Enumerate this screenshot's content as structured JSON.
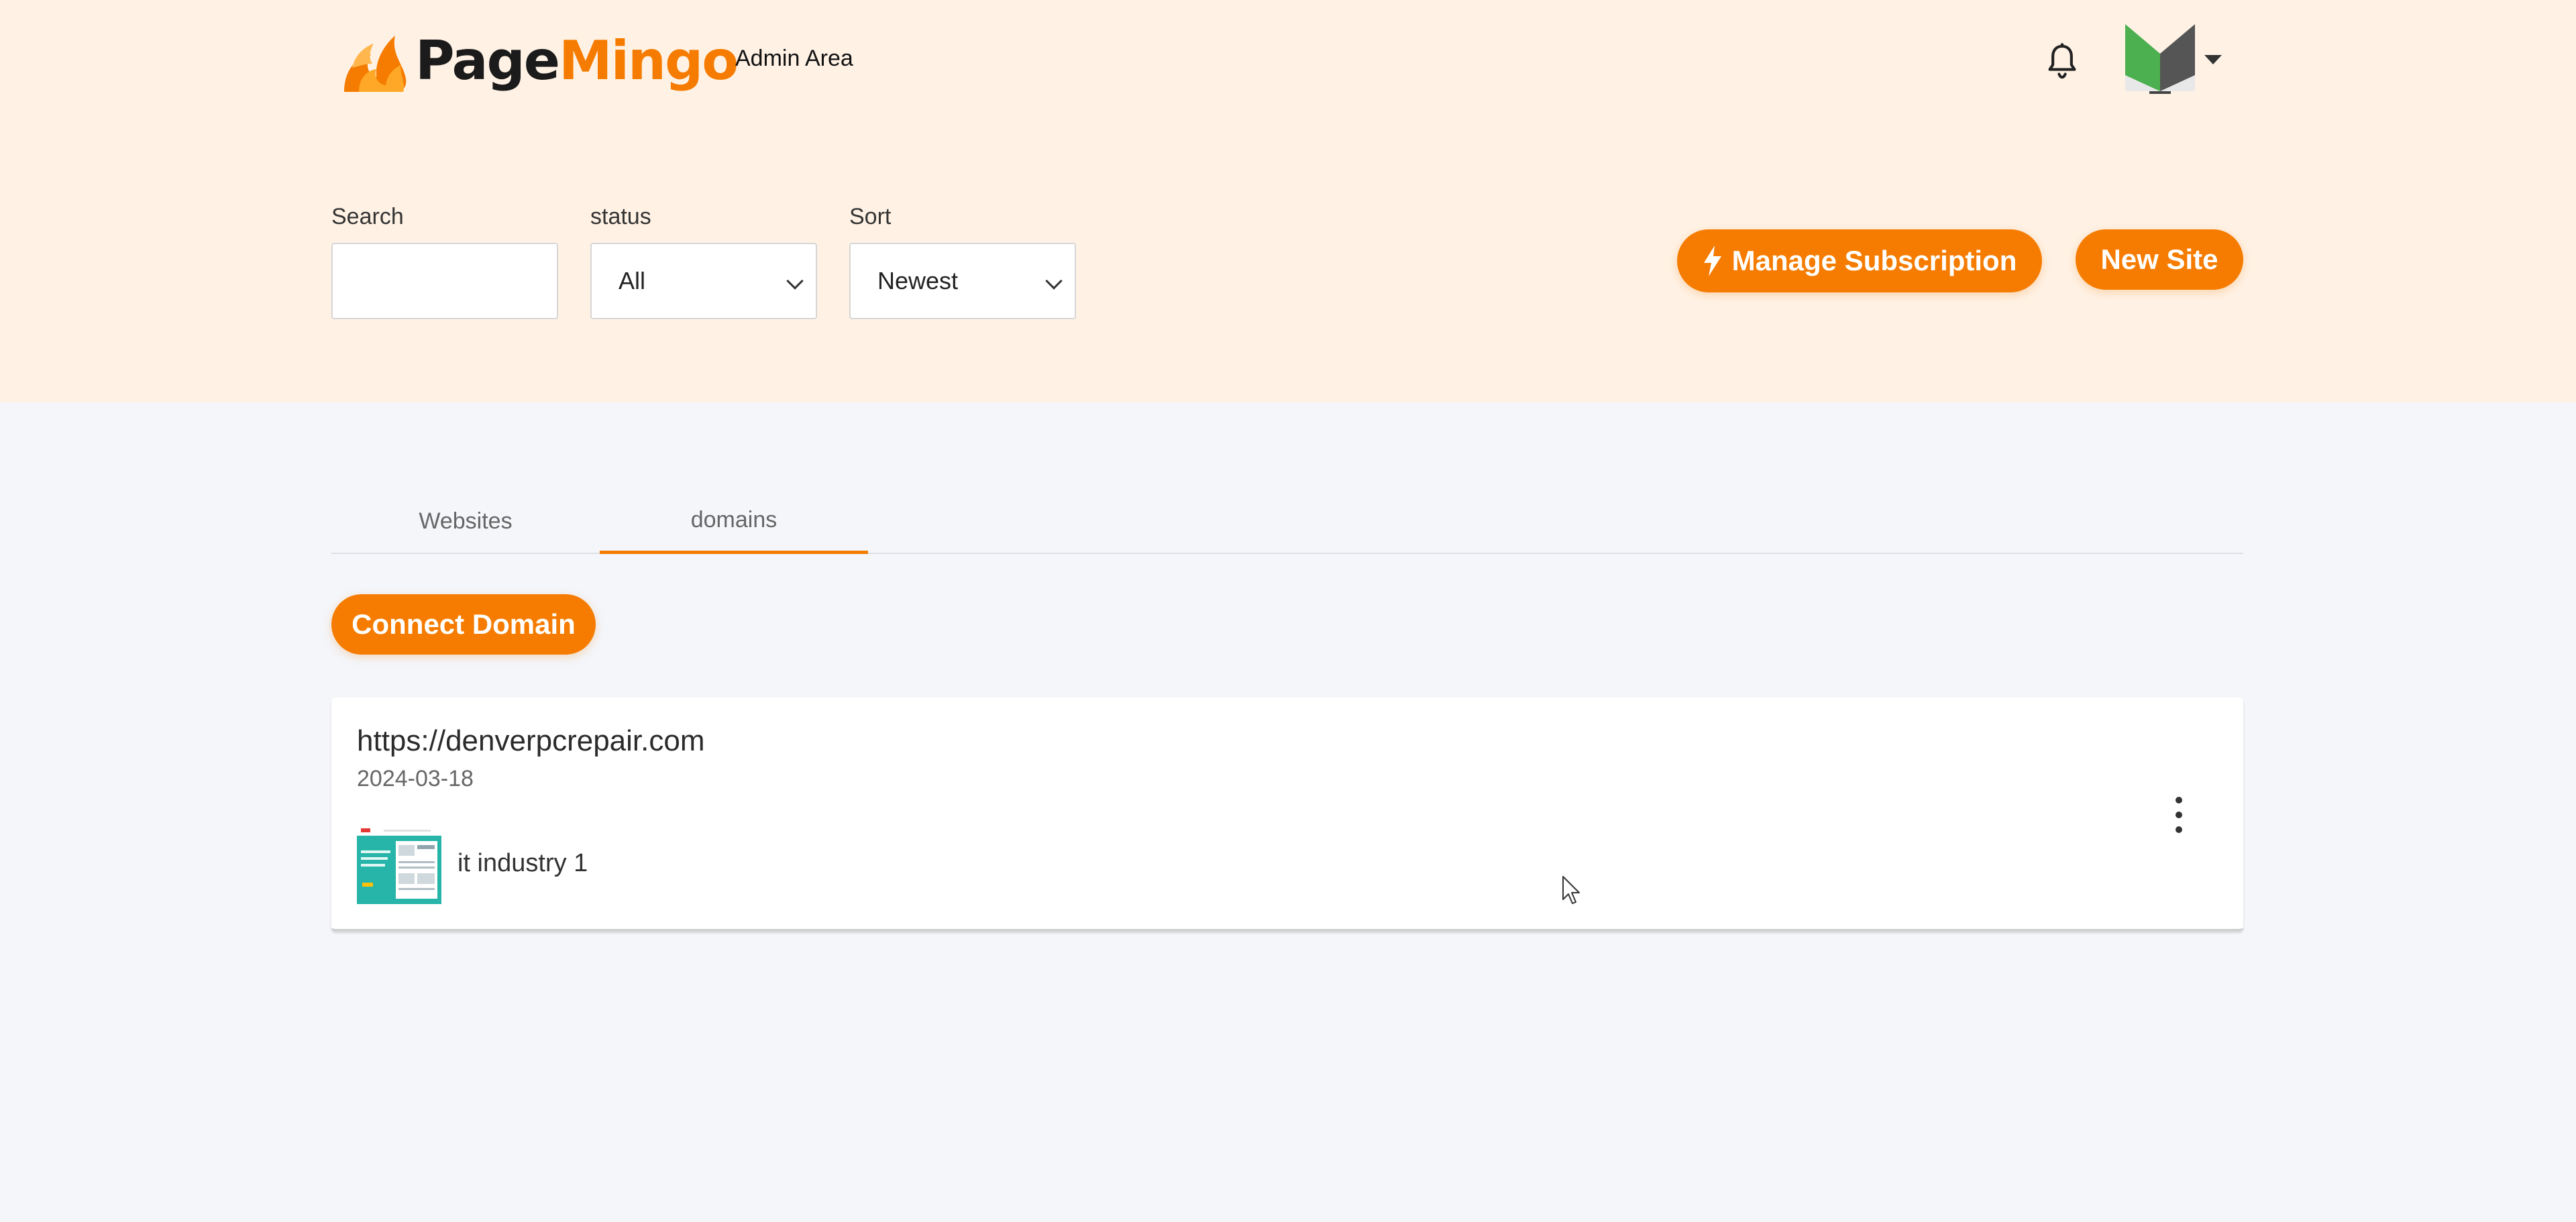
{
  "brand": {
    "part1": "Page",
    "part2": "Mingo",
    "accent": "#f57c00"
  },
  "header": {
    "admin_link": "Admin Area"
  },
  "icons": {
    "notifications": "bell-icon",
    "avatar": "user-avatar-icon",
    "menu": "chevron-down-icon",
    "bolt": "lightning-icon",
    "more": "kebab-menu-icon"
  },
  "filters": {
    "search": {
      "label": "Search",
      "value": ""
    },
    "status": {
      "label": "status",
      "selected": "All"
    },
    "sort": {
      "label": "Sort",
      "selected": "Newest"
    }
  },
  "actions": {
    "manage_subscription": "Manage Subscription",
    "new_site": "New Site",
    "connect_domain": "Connect Domain"
  },
  "tabs": [
    {
      "label": "Websites",
      "active": false
    },
    {
      "label": "domains",
      "active": true
    }
  ],
  "domains": [
    {
      "url": "https://denverpcrepair.com",
      "date": "2024-03-18",
      "site": {
        "name": "it industry 1"
      }
    }
  ]
}
